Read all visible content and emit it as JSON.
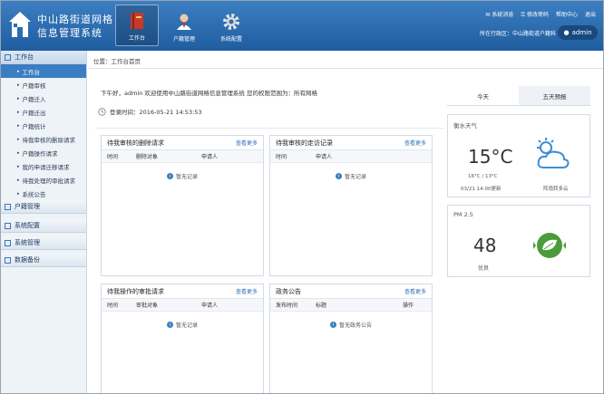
{
  "header": {
    "title_line1": "中山路街道网格",
    "title_line2": "信息管理系统",
    "nav": [
      {
        "label": "工作台",
        "icon": "book-icon"
      },
      {
        "label": "户籍管理",
        "icon": "user-icon"
      },
      {
        "label": "系统配置",
        "icon": "gear-icon"
      }
    ],
    "links": [
      "系统消息",
      "修改密码",
      "帮助中心",
      "退出"
    ],
    "area_label": "所在行政区：中山路街道户籍科",
    "username": "admin"
  },
  "sidebar": {
    "sections": [
      {
        "label": "工作台",
        "open": true
      },
      {
        "label": "户籍管理"
      },
      {
        "label": "系统配置"
      },
      {
        "label": "系统管理"
      },
      {
        "label": "数据备份"
      }
    ],
    "items": [
      "工作台",
      "户籍审核",
      "户籍迁入",
      "户籍迁出",
      "户籍统计",
      "待我审核的删除请求",
      "户籍操作请求",
      "我的申请迁移请求",
      "待我处理的审批请求",
      "系统公告"
    ]
  },
  "breadcrumb": "位置：工作台首页",
  "greeting": "下午好，admin  欢迎使用中山路街道网格信息管理系统    您的权限范围为：所有网格",
  "last_login": "登录时间：2016-05-21 14:53:53",
  "panels": {
    "p1": {
      "title": "待我审核的删除请求",
      "more": "查看更多",
      "cols": [
        "时间",
        "删除对象",
        "申请人"
      ],
      "empty": "暂无记录"
    },
    "p2": {
      "title": "待我审核的走访记录",
      "more": "查看更多",
      "cols": [
        "时间",
        "申请人"
      ],
      "empty": "暂无记录"
    },
    "p3": {
      "title": "待我操作的审批请求",
      "more": "查看更多",
      "cols": [
        "时间",
        "审批对象",
        "申请人"
      ],
      "empty": "暂无记录"
    },
    "p4": {
      "title": "政务公告",
      "more": "查看更多",
      "cols": [
        "发布时间",
        "标题",
        "操作"
      ],
      "empty": "暂无政务公告"
    }
  },
  "weather": {
    "tabs": [
      "今天",
      "五天预报"
    ],
    "city": "衡水天气",
    "temp": "15°C",
    "range": "16°C / 13°C",
    "time": "03/21 14:00更新",
    "desc": "阵雨转多云"
  },
  "pm": {
    "title": "PM 2.5",
    "value": "48",
    "level": "优良"
  },
  "colors": {
    "header": "#2a6db0",
    "accent": "#3a7dc2",
    "pm_green": "#4a9c3a"
  }
}
